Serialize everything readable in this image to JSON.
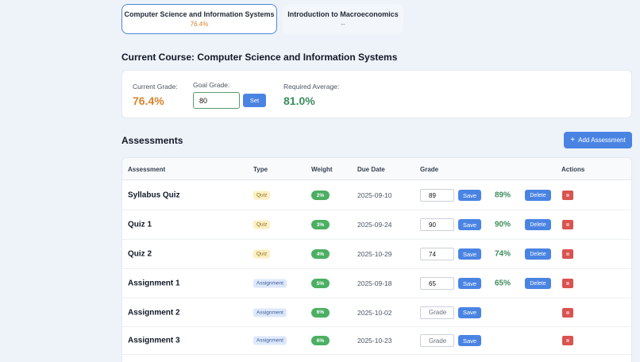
{
  "tabs": [
    {
      "title": "Computer Science and Information Systems",
      "grade": "76.4%"
    },
    {
      "title": "Introduction to Macroeconomics",
      "grade": "--"
    }
  ],
  "course": {
    "heading": "Current Course: Computer Science and Information Systems"
  },
  "grade_card": {
    "current_label": "Current Grade:",
    "current_value": "76.4%",
    "goal_label": "Goal Grade:",
    "goal_value": "80",
    "set_label": "Set",
    "required_label": "Required Average:",
    "required_value": "81.0%"
  },
  "assessments": {
    "heading": "Assessments",
    "add_label": "Add Assessment",
    "columns": {
      "assessment": "Assessment",
      "type": "Type",
      "weight": "Weight",
      "due": "Due Date",
      "grade": "Grade",
      "actions": "Actions"
    },
    "save_label": "Save",
    "delete_label": "Delete",
    "grade_placeholder": "Grade",
    "rows": [
      {
        "name": "Syllabus Quiz",
        "type": "Quiz",
        "weight": "2%",
        "due": "2025-09-10",
        "grade": "89",
        "pct": "89%"
      },
      {
        "name": "Quiz 1",
        "type": "Quiz",
        "weight": "3%",
        "due": "2025-09-24",
        "grade": "90",
        "pct": "90%"
      },
      {
        "name": "Quiz 2",
        "type": "Quiz",
        "weight": "4%",
        "due": "2025-10-29",
        "grade": "74",
        "pct": "74%"
      },
      {
        "name": "Assignment 1",
        "type": "Assignment",
        "weight": "5%",
        "due": "2025-09-18",
        "grade": "65",
        "pct": "65%"
      },
      {
        "name": "Assignment 2",
        "type": "Assignment",
        "weight": "6%",
        "due": "2025-10-02",
        "grade": "",
        "pct": ""
      },
      {
        "name": "Assignment 3",
        "type": "Assignment",
        "weight": "6%",
        "due": "2025-10-23",
        "grade": "",
        "pct": ""
      }
    ]
  },
  "colors": {
    "accent": "#4a84e3",
    "current_grade": "#d9822b",
    "required": "#3c8c5c",
    "weight_badge": "#4caf63",
    "delete_icon": "#d9534f"
  }
}
